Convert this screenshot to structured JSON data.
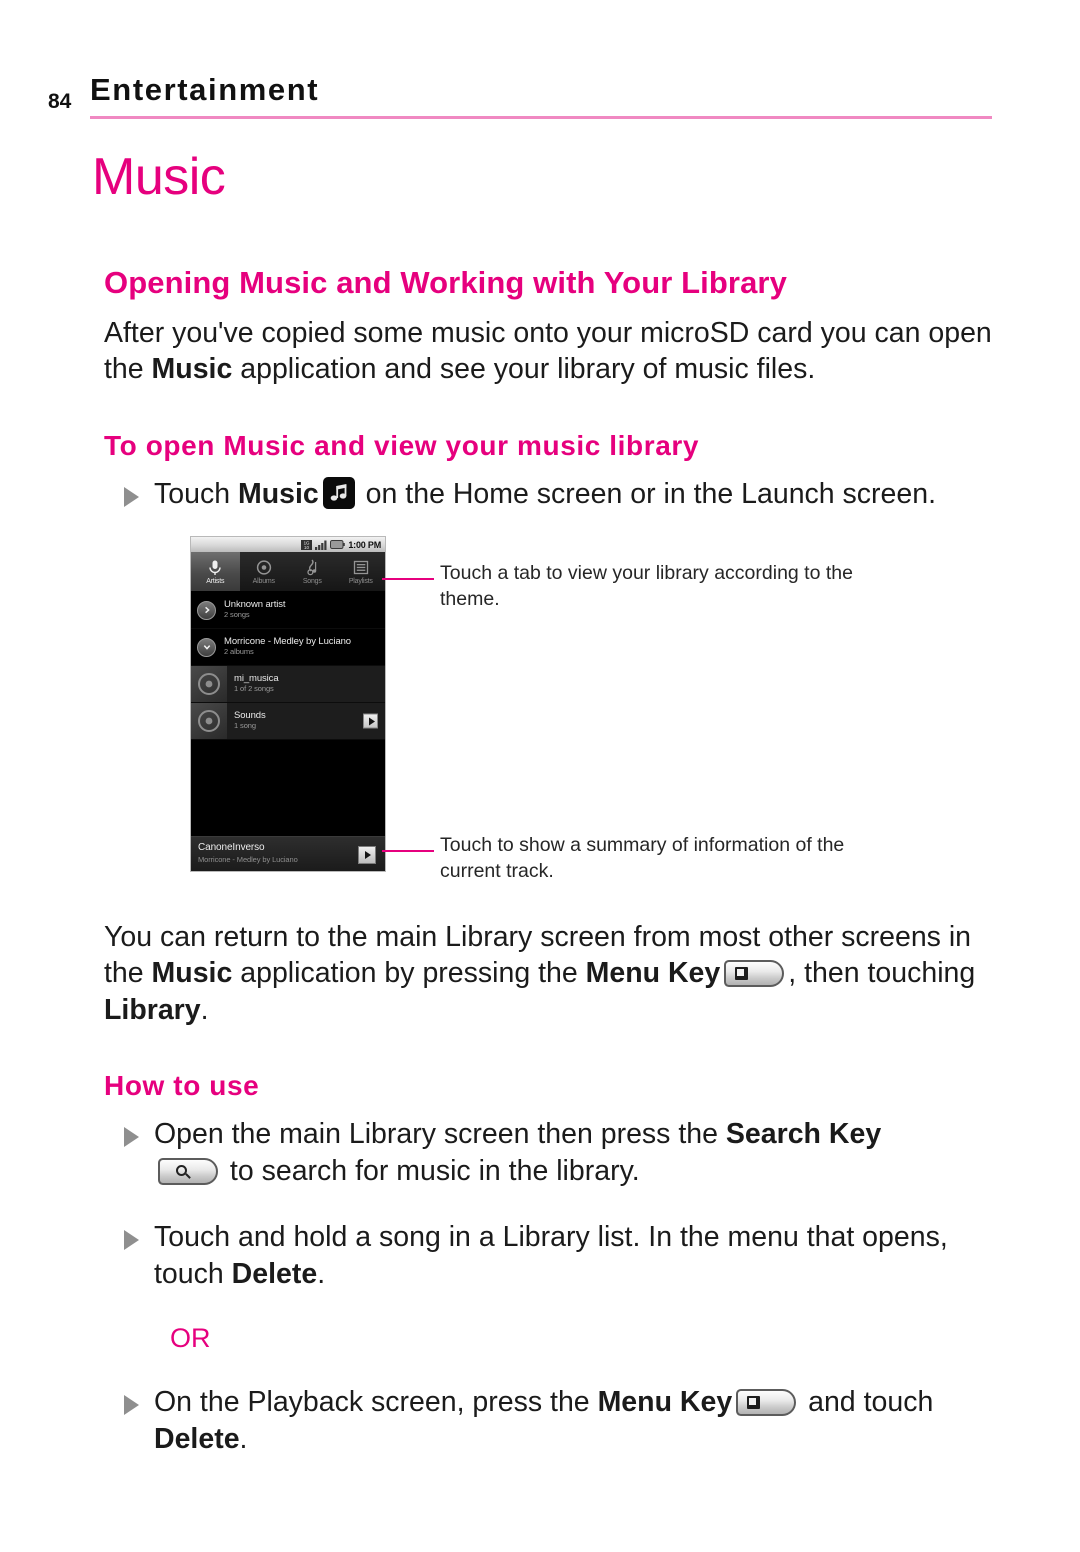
{
  "page": {
    "number": "84",
    "header_title": "Entertainment",
    "accent_color": "#e6007e",
    "rule_color": "#f089c2"
  },
  "chapter": {
    "title": "Music"
  },
  "section": {
    "title": "Opening Music and Working with Your Library",
    "intro_part1": "After you've copied some music onto your microSD card you can open the ",
    "intro_bold": "Music",
    "intro_part2": " application and see your library of music files."
  },
  "subsection": {
    "title": "To open Music and view your music library",
    "bullet_part1": "Touch ",
    "bullet_bold": "Music",
    "bullet_part2": " on the Home screen or in the Launch screen.",
    "music_icon_name": "music-note-icon"
  },
  "figure": {
    "status_bar": {
      "time": "1:00 PM",
      "icons": [
        "sync-icon",
        "signal-bars-icon",
        "battery-icon"
      ]
    },
    "tabs": [
      {
        "label": "Artists",
        "icon": "microphone-icon",
        "selected": true
      },
      {
        "label": "Albums",
        "icon": "disc-icon",
        "selected": false
      },
      {
        "label": "Songs",
        "icon": "music-clef-icon",
        "selected": false
      },
      {
        "label": "Playlists",
        "icon": "list-icon",
        "selected": false
      }
    ],
    "rows": [
      {
        "type": "artist",
        "title": "Unknown artist",
        "subtitle": "2 songs",
        "badge": "chevron-right-icon",
        "play": false
      },
      {
        "type": "artist",
        "title": "Morricone - Medley by Luciano",
        "subtitle": "2 albums",
        "badge": "chevron-down-icon",
        "play": false
      },
      {
        "type": "album",
        "title": "mi_musica",
        "subtitle": "1 of 2 songs",
        "badge": "album-art-icon",
        "play": false
      },
      {
        "type": "album",
        "title": "Sounds",
        "subtitle": "1 song",
        "badge": "album-art-icon",
        "play": true
      }
    ],
    "now_playing": {
      "title": "CanoneInverso",
      "artist": "Morricone - Medley by Luciano",
      "play_icon": "play-icon"
    },
    "callouts": [
      "Touch a tab to view your library according to the theme.",
      "Touch to show a summary of information of the current track."
    ]
  },
  "library_paragraph": {
    "part1": "You can return to the main Library screen from most other screens in the ",
    "bold1": "Music",
    "part2": " application by pressing the ",
    "bold2": "Menu Key",
    "part3": ", then touching ",
    "bold3": "Library",
    "part4": "."
  },
  "how_to_use": {
    "title": "How to use",
    "items": [
      {
        "part1": "Open the main Library screen then press the ",
        "bold1": "Search Key",
        "part2": " to search for music in the library.",
        "key_icon": "search-key-icon"
      },
      {
        "part1": "Touch and hold a song in a Library list. In the menu that opens, touch ",
        "bold1": "Delete",
        "part2": "."
      },
      {
        "part1": "On the Playback screen, press the ",
        "bold1": "Menu Key",
        "part2": " and touch ",
        "bold2": "Delete",
        "part3": ".",
        "key_icon": "menu-key-icon"
      }
    ],
    "or_label": "OR"
  }
}
